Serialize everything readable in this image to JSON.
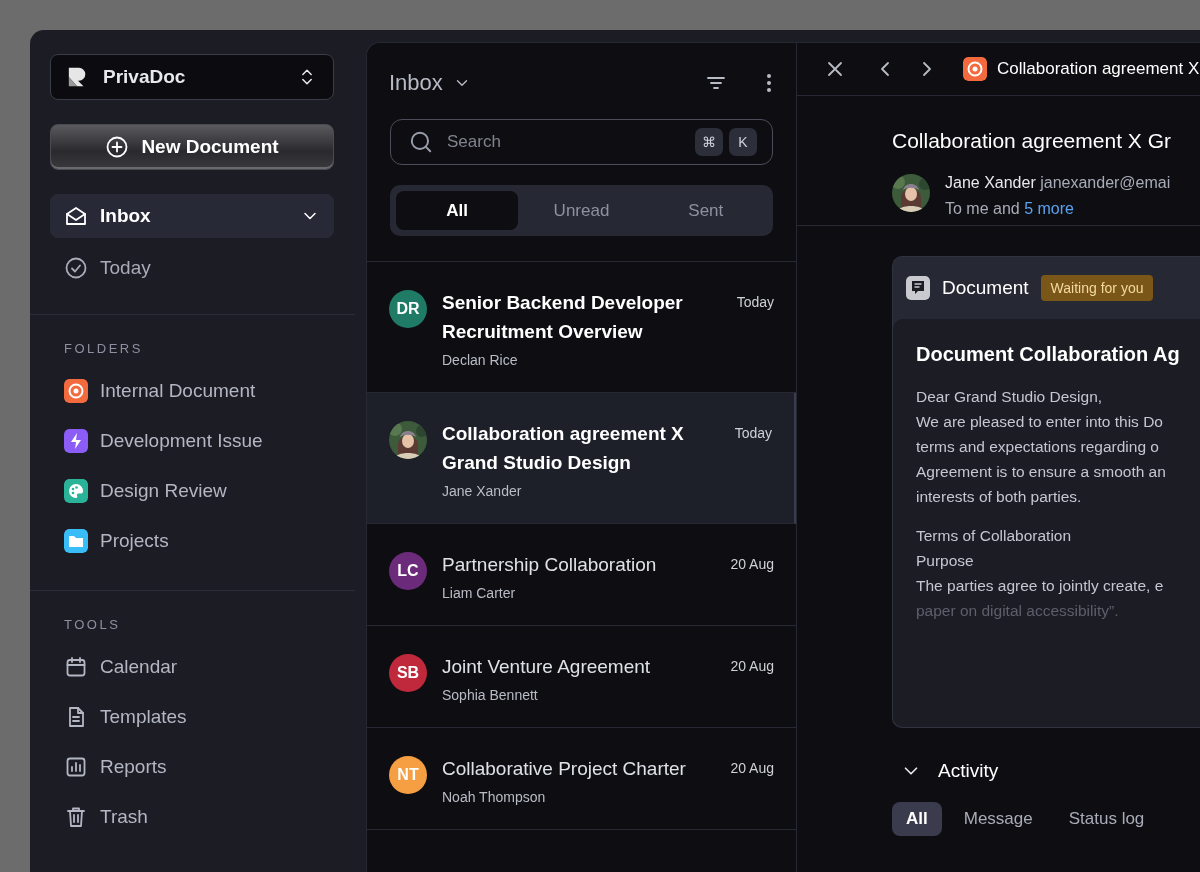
{
  "workspace": {
    "name": "PrivaDoc"
  },
  "new_button": {
    "label": "New Document"
  },
  "nav": [
    {
      "label": "Inbox",
      "selected": true
    },
    {
      "label": "Today",
      "selected": false
    }
  ],
  "folders": {
    "heading": "FOLDERS",
    "items": [
      {
        "label": "Internal Document",
        "color": "#f26a3d"
      },
      {
        "label": "Development Issue",
        "color": "#8b5cf6"
      },
      {
        "label": "Design Review",
        "color": "#2bb39a"
      },
      {
        "label": "Projects",
        "color": "#38bdf8"
      }
    ]
  },
  "tools": {
    "heading": "TOOLS",
    "items": [
      {
        "label": "Calendar"
      },
      {
        "label": "Templates"
      },
      {
        "label": "Reports"
      },
      {
        "label": "Trash"
      }
    ]
  },
  "list": {
    "title": "Inbox",
    "search": {
      "placeholder": "Search",
      "keys": [
        "⌘",
        "K"
      ]
    },
    "tabs": [
      {
        "label": "All",
        "selected": true
      },
      {
        "label": "Unread",
        "selected": false
      },
      {
        "label": "Sent",
        "selected": false
      }
    ],
    "rows": [
      {
        "title": "Senior Backend Developer Recruitment Overview",
        "sender": "Declan Rice",
        "date": "Today",
        "unread": true,
        "selected": false,
        "avatar": {
          "kind": "initials",
          "initials": "DR",
          "color": "#1f7a66"
        }
      },
      {
        "title": "Collaboration agreement X Grand Studio Design",
        "sender": "Jane Xander",
        "date": "Today",
        "unread": true,
        "selected": true
      },
      {
        "title": "Partnership Collaboration",
        "sender": "Liam Carter",
        "date": "20 Aug",
        "unread": false,
        "selected": false,
        "avatar": {
          "kind": "initials",
          "initials": "LC",
          "color": "#6b2a7a"
        }
      },
      {
        "title": "Joint Venture Agreement",
        "sender": "Sophia Bennett",
        "date": "20 Aug",
        "unread": false,
        "selected": false,
        "avatar": {
          "kind": "initials",
          "initials": "SB",
          "color": "#c0283c"
        }
      },
      {
        "title": "Collaborative Project Charter",
        "sender": "Noah Thompson",
        "date": "20 Aug",
        "unread": false,
        "selected": false,
        "avatar": {
          "kind": "initials",
          "initials": "NT",
          "color": "#f59e42"
        }
      }
    ]
  },
  "detail": {
    "tab_title": "Collaboration agreement X",
    "subject": "Collaboration agreement X Gr",
    "sender": {
      "name": "Jane Xander",
      "email": "janexander@emai",
      "recipients": "To me and **5 more**"
    },
    "document": {
      "label": "Document",
      "status": "Waiting for you",
      "heading": "Document Collaboration Ag",
      "paragraphs": [
        {
          "lines": [
            "Dear Grand Studio Design,",
            "We are pleased to enter into this Do",
            "terms and expectations regarding o",
            "Agreement is to ensure a smooth an",
            "interests of both parties."
          ],
          "fade_last": false
        },
        {
          "lines": [
            "Terms of Collaboration",
            "Purpose",
            "The parties agree to jointly create, e",
            "paper on digital accessibility”."
          ],
          "fade_last": true
        }
      ]
    },
    "activity": {
      "title": "Activity",
      "expanded": true,
      "tabs": [
        {
          "label": "All",
          "selected": true
        },
        {
          "label": "Message",
          "selected": false
        },
        {
          "label": "Status log",
          "selected": false
        }
      ]
    }
  }
}
